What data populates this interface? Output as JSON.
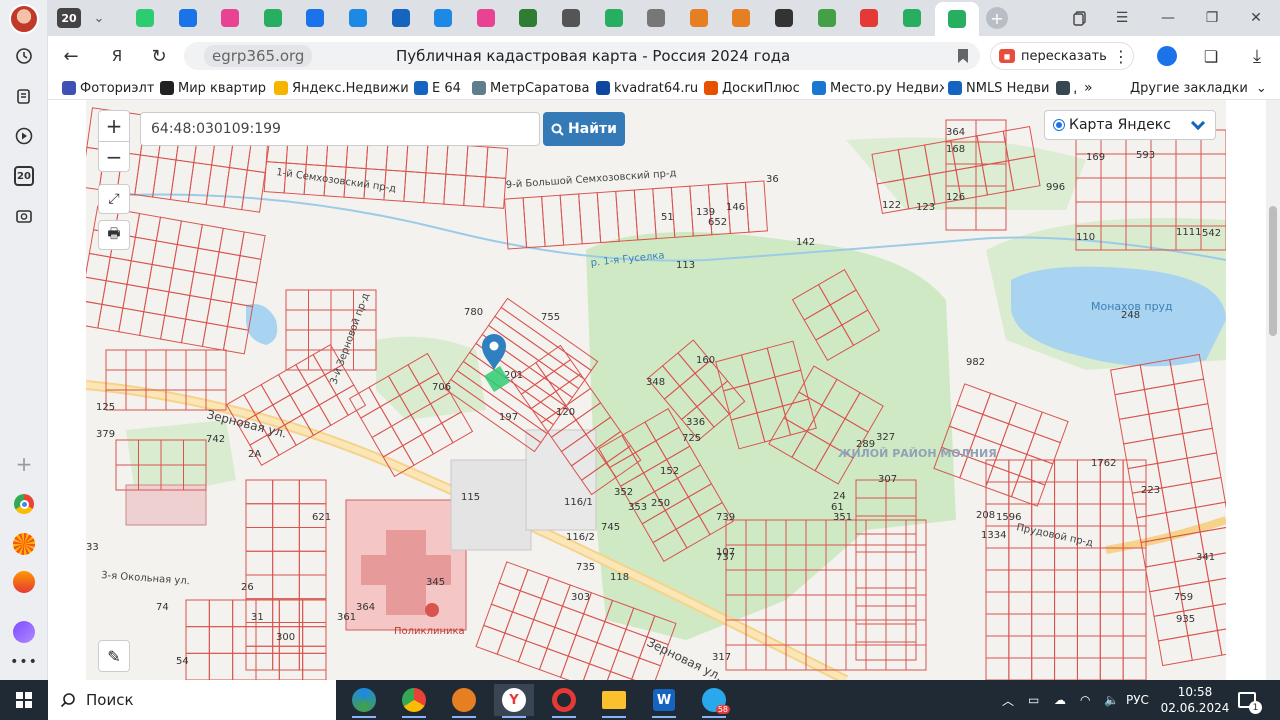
{
  "browser": {
    "tab_counter": "20",
    "tabs": [
      {
        "name": "tab-20",
        "color": "#444"
      },
      {
        "name": "tab-arrow",
        "color": "#2ecc71"
      },
      {
        "name": "tab-check1",
        "color": "#1a73e8"
      },
      {
        "name": "tab-check2",
        "color": "#e84393"
      },
      {
        "name": "tab-lambda",
        "color": "#27ae60"
      },
      {
        "name": "tab-check3",
        "color": "#1a73e8"
      },
      {
        "name": "tab-bird",
        "color": "#1e88e5"
      },
      {
        "name": "tab-26",
        "color": "#1565c0"
      },
      {
        "name": "tab-bird2",
        "color": "#1e88e5"
      },
      {
        "name": "tab-check4",
        "color": "#e84393"
      },
      {
        "name": "tab-v",
        "color": "#2e7d32"
      },
      {
        "name": "tab-book",
        "color": "#555"
      },
      {
        "name": "tab-ok",
        "color": "#27ae60"
      },
      {
        "name": "tab-doc",
        "color": "#777"
      },
      {
        "name": "tab-v2",
        "color": "#e67e22"
      },
      {
        "name": "tab-v3",
        "color": "#e67e22"
      },
      {
        "name": "tab-g",
        "color": "#333"
      },
      {
        "name": "tab-map",
        "color": "#43a047"
      },
      {
        "name": "tab-ya",
        "color": "#e53935"
      },
      {
        "name": "tab-ok2",
        "color": "#27ae60"
      },
      {
        "name": "tab-active",
        "color": "#27ae60"
      }
    ],
    "domain": "egrp365.org",
    "page_title": "Публичная кадастровая карта - Россия 2024 года",
    "retell_label": "пересказать",
    "bookmarks": [
      {
        "label": "Фоториэлт",
        "color": "#3f51b5"
      },
      {
        "label": "Мир квартир",
        "color": "#222"
      },
      {
        "label": "Яндекс.Недвижи",
        "color": "#f4b400"
      },
      {
        "label": "E 64",
        "color": "#1565c0"
      },
      {
        "label": "МетрСаратова",
        "color": "#607d8b"
      },
      {
        "label": "kvadrat64.ru",
        "color": "#0d47a1"
      },
      {
        "label": "ДоскиПлюс",
        "color": "#e65100"
      },
      {
        "label": "Место.ру Недвиж",
        "color": "#1976d2"
      },
      {
        "label": "NMLS Недви",
        "color": "#1565c0"
      },
      {
        "label": "Д",
        "color": "#37474f"
      }
    ],
    "more_bookmarks": "»",
    "other_bookmarks": "Другие закладки"
  },
  "map": {
    "search_value": "64:48:030109:199",
    "search_button": "Найти",
    "layer_label": "Карта Яндекс",
    "labels": {
      "street_zernovaya": "Зерновая ул.",
      "street_zernovaya2": "Зерновая ул.",
      "river": "р. 1-я Гуселка",
      "pond": "Монахов пруд",
      "district": "ЖИЛОЙ РАЙОН МОЛНИЯ",
      "clinic": "Поликлиника",
      "street_okolnaya": "3-я Окольная ул.",
      "prudovoy": "Прудовой пр-д",
      "semkhoz": "9-й Большой Семхозовский пр-д",
      "sennoy": "3-й Зерновой пр-д",
      "lane_left": "1-й Семхозовский пр-д"
    },
    "parcel_numbers": [
      "36",
      "982",
      "120",
      "115",
      "116/1",
      "116/2",
      "742",
      "379",
      "125",
      "33",
      "74",
      "364",
      "2A",
      "621",
      "345",
      "317",
      "118",
      "307",
      "248",
      "755",
      "780",
      "201",
      "197",
      "706",
      "1334",
      "1762",
      "1596",
      "208",
      "223",
      "341",
      "759",
      "935",
      "300",
      "54",
      "31",
      "26",
      "24",
      "351",
      "61",
      "327",
      "289",
      "107",
      "737",
      "739",
      "725",
      "152",
      "336",
      "250",
      "745",
      "735",
      "303",
      "353",
      "348",
      "352",
      "160",
      "361",
      "364",
      "168",
      "169",
      "593",
      "996",
      "1111",
      "542",
      "110",
      "51",
      "139",
      "652",
      "146",
      "142",
      "113",
      "122",
      "123",
      "126"
    ]
  },
  "taskbar": {
    "search_label": "Поиск",
    "language": "РУС",
    "time": "10:58",
    "date": "02.06.2024",
    "notification_count": "1",
    "telegram_badge": "58"
  }
}
